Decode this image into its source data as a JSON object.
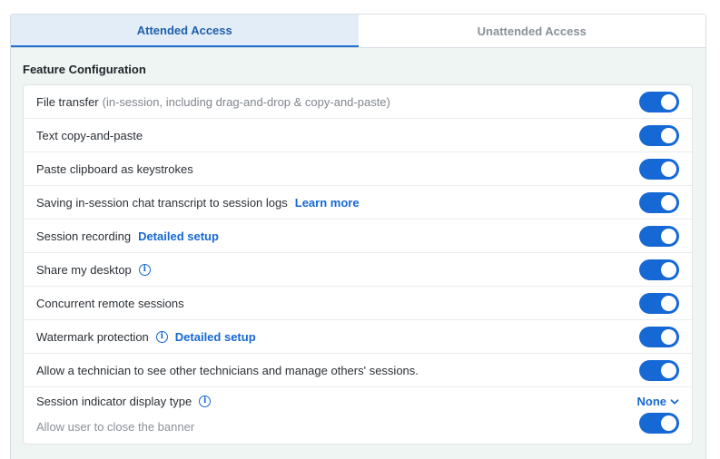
{
  "tabs": [
    {
      "label": "Attended Access",
      "active": true
    },
    {
      "label": "Unattended Access",
      "active": false
    }
  ],
  "section_title": "Feature Configuration",
  "rows": [
    {
      "label": "File transfer",
      "note": "(in-session, including drag-and-drop & copy-and-paste)",
      "enabled": true
    },
    {
      "label": "Text copy-and-paste",
      "enabled": true
    },
    {
      "label": "Paste clipboard as keystrokes",
      "enabled": true
    },
    {
      "label": "Saving in-session chat transcript to session logs",
      "link": "Learn more",
      "enabled": true
    },
    {
      "label": "Session recording",
      "link": "Detailed setup",
      "enabled": true
    },
    {
      "label": "Share my desktop",
      "info_icon": true,
      "enabled": true
    },
    {
      "label": "Concurrent remote sessions",
      "enabled": true
    },
    {
      "label": "Watermark protection",
      "info_icon": true,
      "link": "Detailed setup",
      "enabled": true
    },
    {
      "label": "Allow a technician to see other technicians and manage others' sessions.",
      "enabled": true
    }
  ],
  "indicator": {
    "label": "Session indicator display type",
    "selected": "None",
    "sub_label": "Allow user to close the banner",
    "sub_enabled": true
  },
  "colors": {
    "accent": "#1668d4",
    "panel_bg": "#eef5f2",
    "active_tab_bg": "#e3edf8"
  },
  "icons": {
    "info": "info-icon",
    "chevron": "chevron-down-icon"
  }
}
